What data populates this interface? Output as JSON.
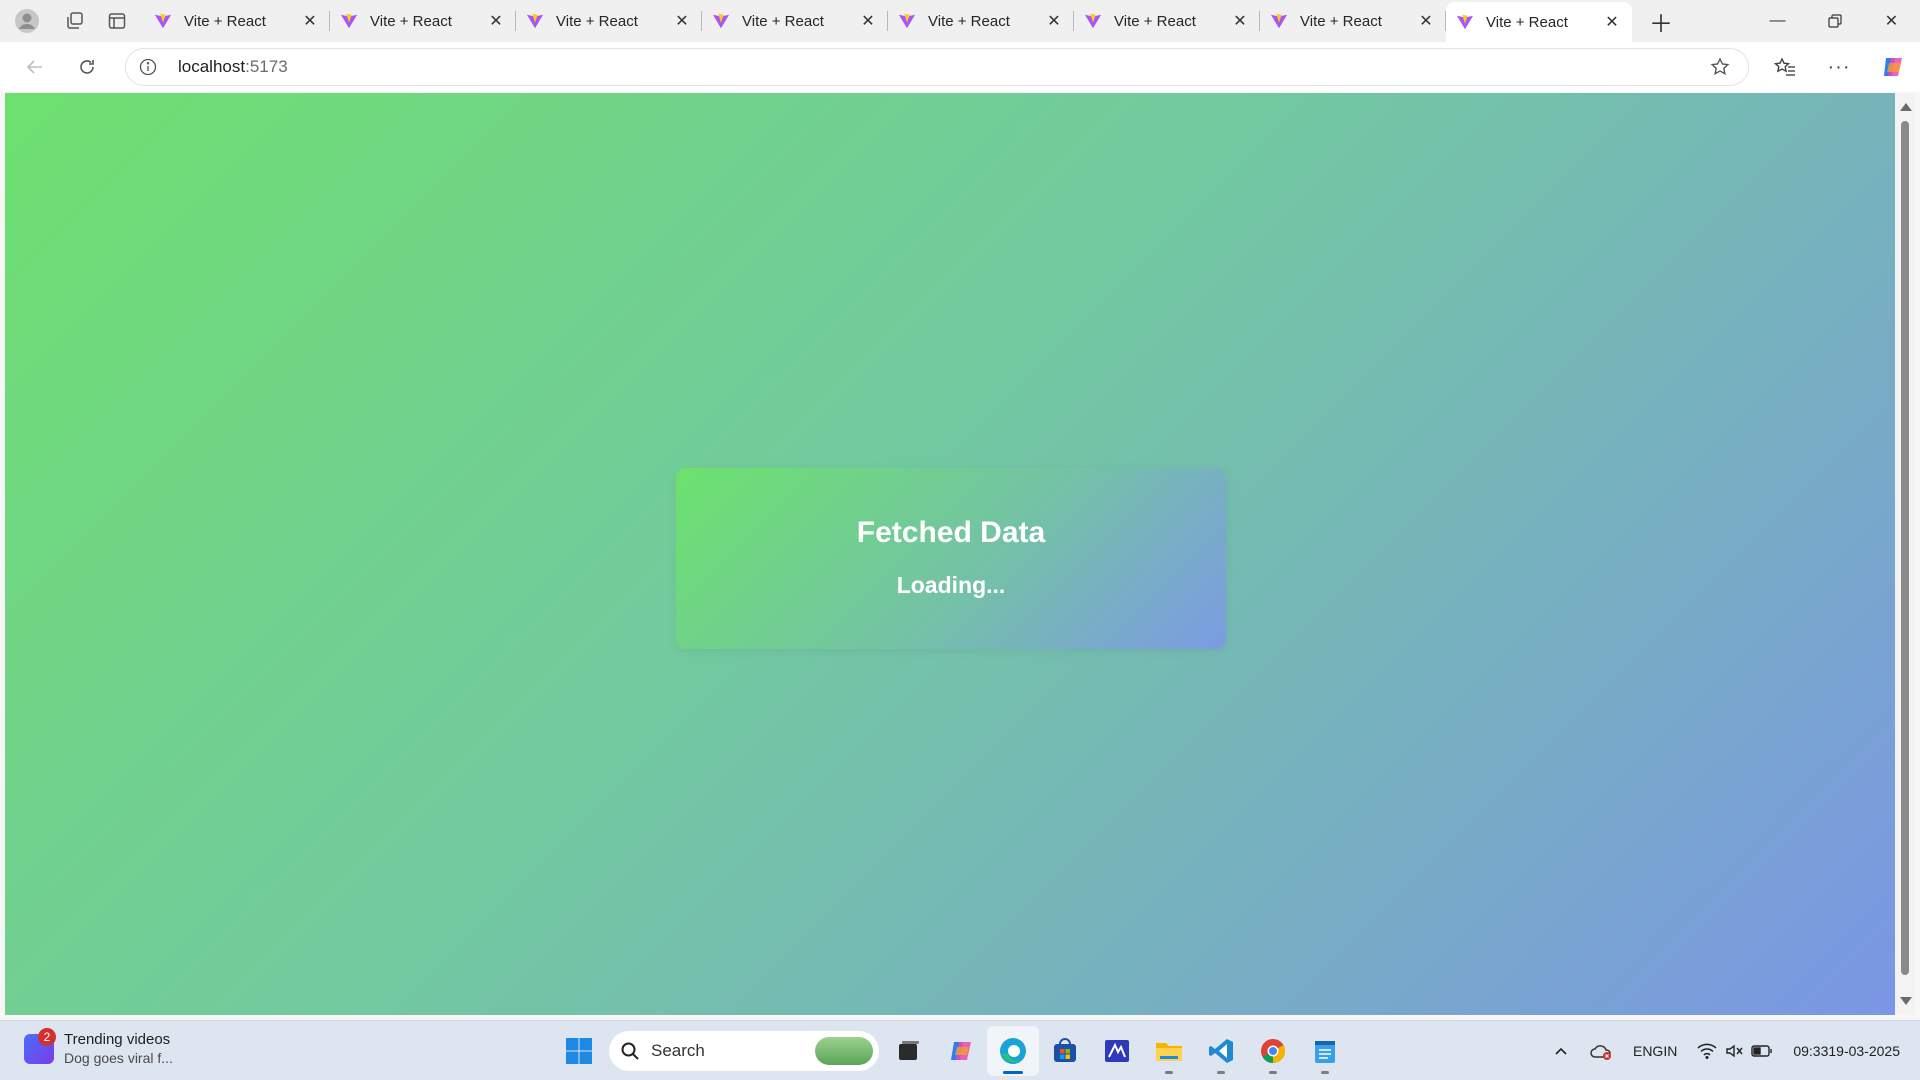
{
  "browser": {
    "tabs": [
      {
        "title": "Vite + React",
        "active": false
      },
      {
        "title": "Vite + React",
        "active": false
      },
      {
        "title": "Vite + React",
        "active": false
      },
      {
        "title": "Vite + React",
        "active": false
      },
      {
        "title": "Vite + React",
        "active": false
      },
      {
        "title": "Vite + React",
        "active": false
      },
      {
        "title": "Vite + React",
        "active": false
      },
      {
        "title": "Vite + React",
        "active": true
      }
    ],
    "address": {
      "host": "localhost",
      "port": ":5173"
    }
  },
  "page": {
    "heading": "Fetched Data",
    "status": "Loading..."
  },
  "taskbar": {
    "news": {
      "badge": "2",
      "title": "Trending videos",
      "subtitle": "Dog goes viral f..."
    },
    "search_label": "Search",
    "language": {
      "line1": "ENG",
      "line2": "IN"
    },
    "clock": {
      "time": "09:33",
      "date": "19-03-2025"
    }
  },
  "colors": {
    "page_gradient_start": "#6ee06f",
    "page_gradient_end": "#7b96e6",
    "accent": "#0067c0"
  }
}
